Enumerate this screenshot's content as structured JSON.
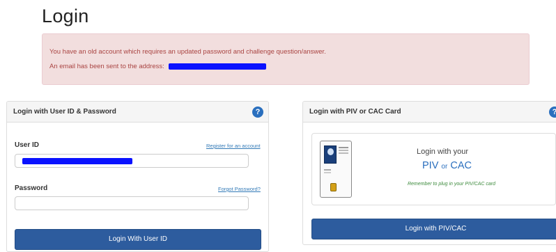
{
  "page": {
    "title": "Login"
  },
  "alert": {
    "line1": "You have an old account which requires an updated password and challenge question/answer.",
    "line2": "An email has been sent to the address:",
    "line2_redacted": true
  },
  "userid_panel": {
    "title": "Login with User ID & Password",
    "help_icon": "?",
    "userid_label": "User ID",
    "register_link": "Register for an account",
    "userid_value_redacted": true,
    "password_label": "Password",
    "forgot_link": "Forgot Password?",
    "password_value": "",
    "login_button": "Login With User ID"
  },
  "piv_panel": {
    "title": "Login with PIV or CAC Card",
    "help_icon": "?",
    "line1": "Login with your",
    "line2_a": "PIV",
    "line2_or": "or",
    "line2_b": "CAC",
    "note": "Remember to plug in your PIV/CAC card",
    "login_button": "Login with PIV/CAC"
  },
  "colors": {
    "alert_bg": "#f2dede",
    "alert_text": "#a94442",
    "primary_button": "#2d5c9e",
    "link": "#337ab7",
    "help_icon": "#2a6fbe",
    "redaction": "#0a12ff"
  }
}
